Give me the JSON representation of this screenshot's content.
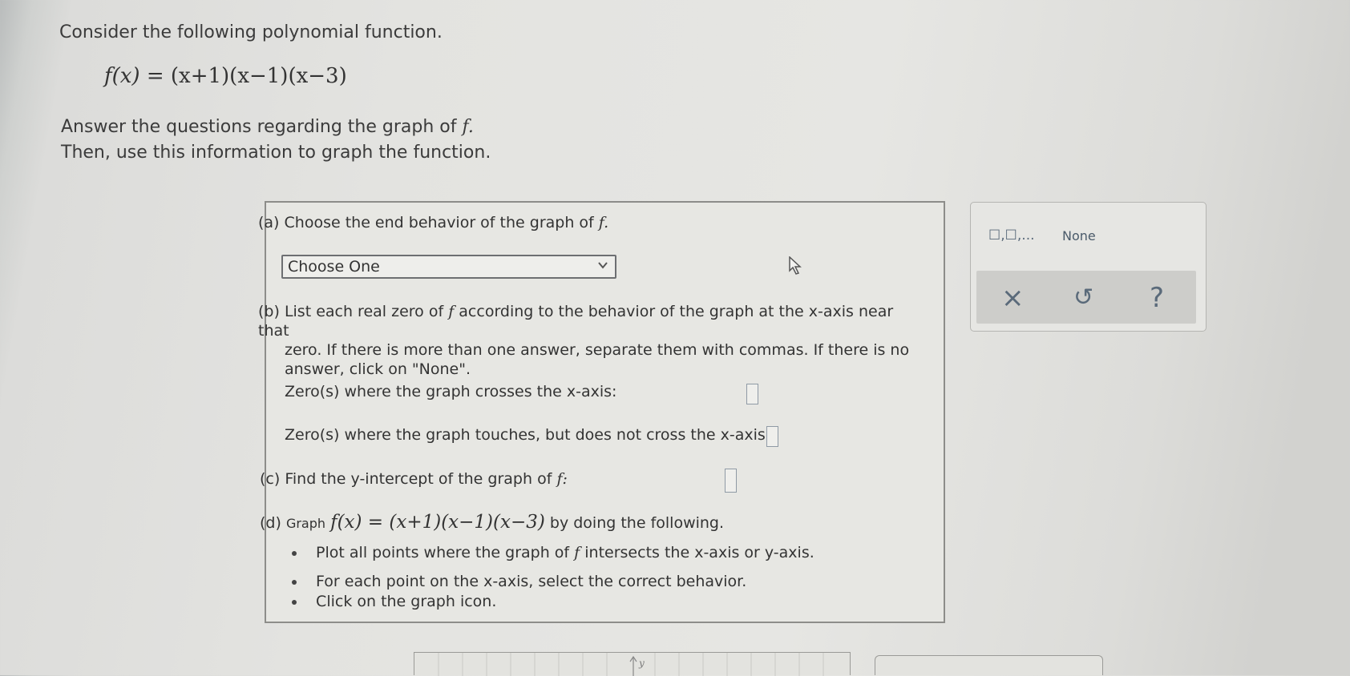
{
  "intro": {
    "line1": "Consider the following polynomial function.",
    "line2": "Answer the questions regarding the graph of",
    "line2_var": "f.",
    "line3": "Then, use this information to graph the function."
  },
  "function": {
    "lhs": "f(x)",
    "rhs": "= (x+1)(x−1)(x−3)"
  },
  "part_a": {
    "label": "(a)",
    "text": "Choose the end behavior of the graph of",
    "var": "f.",
    "dropdown_value": "Choose One"
  },
  "part_b": {
    "label": "(b)",
    "text_line1_pre": "List each real zero of",
    "text_line1_var": "f",
    "text_line1_post": "according to the behavior of the graph at the",
    "x_axis_line1": "x-axis near that",
    "text_line2": "zero. If there is more than one answer, separate them with commas. If there is no",
    "text_line3": "answer, click on \"None\".",
    "crosses_label_pre": "Zero(s) where the graph crosses the",
    "crosses_label_var": "x-axis:",
    "touches_label_pre": "Zero(s) where the graph touches, but does not cross the",
    "touches_label_var": "x-axis:"
  },
  "part_c": {
    "label": "(c)",
    "text_pre": "Find the",
    "text_var": "y-intercept of the graph of",
    "text_post": "f:"
  },
  "part_d": {
    "label": "(d)",
    "text_pre": "Graph",
    "equation": "f(x) = (x+1)(x−1)(x−3)",
    "text_post": "by doing the following.",
    "bullets": [
      {
        "pre": "Plot all points where the graph of",
        "var": "f",
        "mid": "intersects the",
        "var2": "x-axis or",
        "var3": "y-axis.",
        "post": ""
      },
      {
        "pre": "For each point on the",
        "var": "x-axis, select the correct behavior.",
        "mid": "",
        "var2": "",
        "var3": "",
        "post": ""
      },
      {
        "pre": "Click on the graph icon.",
        "var": "",
        "mid": "",
        "var2": "",
        "var3": "",
        "post": ""
      }
    ]
  },
  "sidebar": {
    "list_template": "☐,☐,...",
    "none_label": "None",
    "clear_icon": "×",
    "undo_icon": "↺",
    "help_icon": "?"
  },
  "graph_axis_label": "y",
  "colors": {
    "text": "#333333",
    "panel_border": "#8d8d8a",
    "input_border": "#8f9aa5",
    "toolbar_bg": "#cdcdca",
    "tool_icon": "#5a6a7a"
  }
}
